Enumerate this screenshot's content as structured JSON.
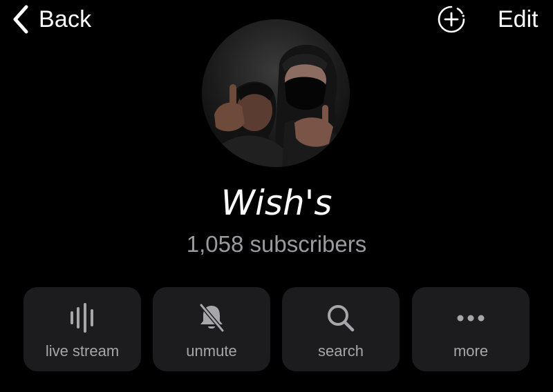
{
  "header": {
    "back_label": "Back",
    "edit_label": "Edit"
  },
  "channel": {
    "name": "Wish's",
    "subscribers": "1,058 subscribers"
  },
  "actions": [
    {
      "label": "live stream",
      "icon": "waveform-icon"
    },
    {
      "label": "unmute",
      "icon": "bell-slash-icon"
    },
    {
      "label": "search",
      "icon": "magnifier-icon"
    },
    {
      "label": "more",
      "icon": "ellipsis-icon"
    }
  ],
  "colors": {
    "background": "#000000",
    "button_background": "#1c1c1e",
    "secondary_text": "#9a9a9f",
    "icon_gray": "#a6a6ab"
  }
}
